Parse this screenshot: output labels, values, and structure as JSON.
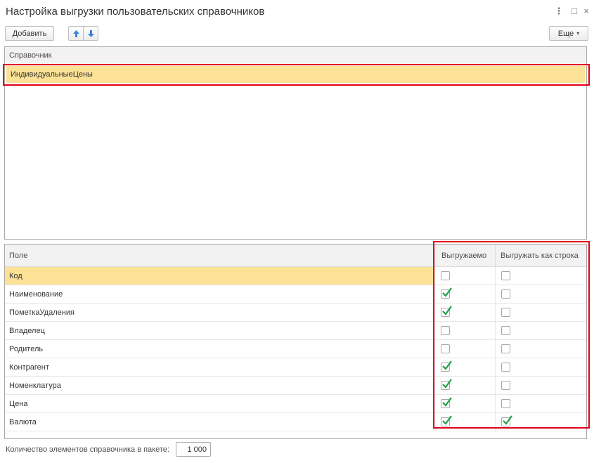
{
  "window": {
    "title": "Настройка выгрузки пользовательских справочников",
    "more_icon": "⋮",
    "maximize_icon": "□",
    "close_icon": "×"
  },
  "toolbar": {
    "add_label": "Добавить",
    "up_icon": "arrow-up-icon",
    "down_icon": "arrow-down-icon",
    "more_label": "Еще"
  },
  "colors": {
    "selection": "#fbe295",
    "highlight_box": "#e3001b",
    "check": "#1f9e4a"
  },
  "catalogs": {
    "header": "Справочник",
    "rows": [
      "ИндивидуальныеЦены"
    ]
  },
  "fields": {
    "headers": {
      "field": "Поле",
      "exportable": "Выгружаемо",
      "as_string": "Выгружать как строка"
    },
    "rows": [
      {
        "name": "Код",
        "exportable": false,
        "as_string": false
      },
      {
        "name": "Наименование",
        "exportable": true,
        "as_string": false
      },
      {
        "name": "ПометкаУдаления",
        "exportable": true,
        "as_string": false
      },
      {
        "name": "Владелец",
        "exportable": false,
        "as_string": false
      },
      {
        "name": "Родитель",
        "exportable": false,
        "as_string": false
      },
      {
        "name": "Контрагент",
        "exportable": true,
        "as_string": false
      },
      {
        "name": "Номенклатура",
        "exportable": true,
        "as_string": false
      },
      {
        "name": "Цена",
        "exportable": true,
        "as_string": false
      },
      {
        "name": "Валюта",
        "exportable": true,
        "as_string": true
      }
    ]
  },
  "footer": {
    "batch_label": "Количество элементов справочника в пакете:",
    "batch_value": "1 000"
  }
}
